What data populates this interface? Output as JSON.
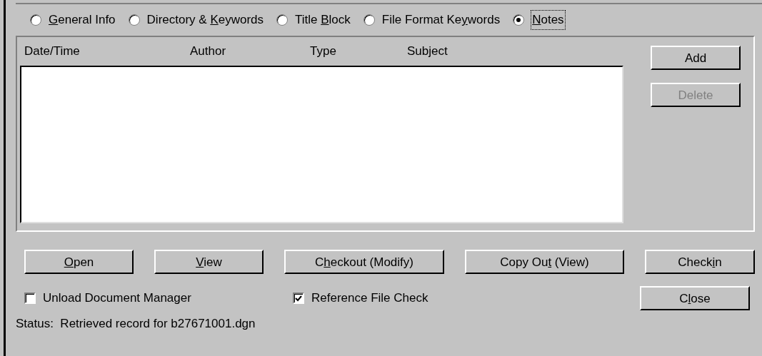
{
  "view_options": [
    {
      "label": {
        "key": "G",
        "after": "eneral Info"
      },
      "selected": false
    },
    {
      "label": {
        "before": "Directory & ",
        "key": "K",
        "after": "eywords"
      },
      "selected": false
    },
    {
      "label": {
        "before": "Title ",
        "key": "B",
        "after": "lock"
      },
      "selected": false
    },
    {
      "label": {
        "before": "File Format Ke",
        "key": "y",
        "after": "words"
      },
      "selected": false
    },
    {
      "label": {
        "key": "N",
        "after": "otes"
      },
      "selected": true
    }
  ],
  "notes_table": {
    "columns": [
      "Date/Time",
      "Author",
      "Type",
      "Subject"
    ]
  },
  "side_buttons": [
    {
      "label": {
        "after": "Add"
      },
      "disabled": false
    },
    {
      "label": {
        "after": "Delete"
      },
      "disabled": true
    }
  ],
  "action_buttons": [
    {
      "label": {
        "key": "O",
        "after": "pen"
      }
    },
    {
      "label": {
        "key": "V",
        "after": "iew"
      }
    },
    {
      "label": {
        "before": "C",
        "key": "h",
        "after": "eckout (Modify)"
      }
    },
    {
      "label": {
        "before": "Copy Ou",
        "key": "t",
        "after": " (View)"
      }
    },
    {
      "label": {
        "before": "Check",
        "key": "i",
        "after": "n"
      }
    }
  ],
  "options": [
    {
      "label": "Unload Document Manager",
      "checked": false
    },
    {
      "label": "Reference File Check",
      "checked": true
    }
  ],
  "close_button": {
    "label": {
      "before": "C",
      "key": "l",
      "after": "ose"
    }
  },
  "status": "Status:  Retrieved record for b27671001.dgn"
}
